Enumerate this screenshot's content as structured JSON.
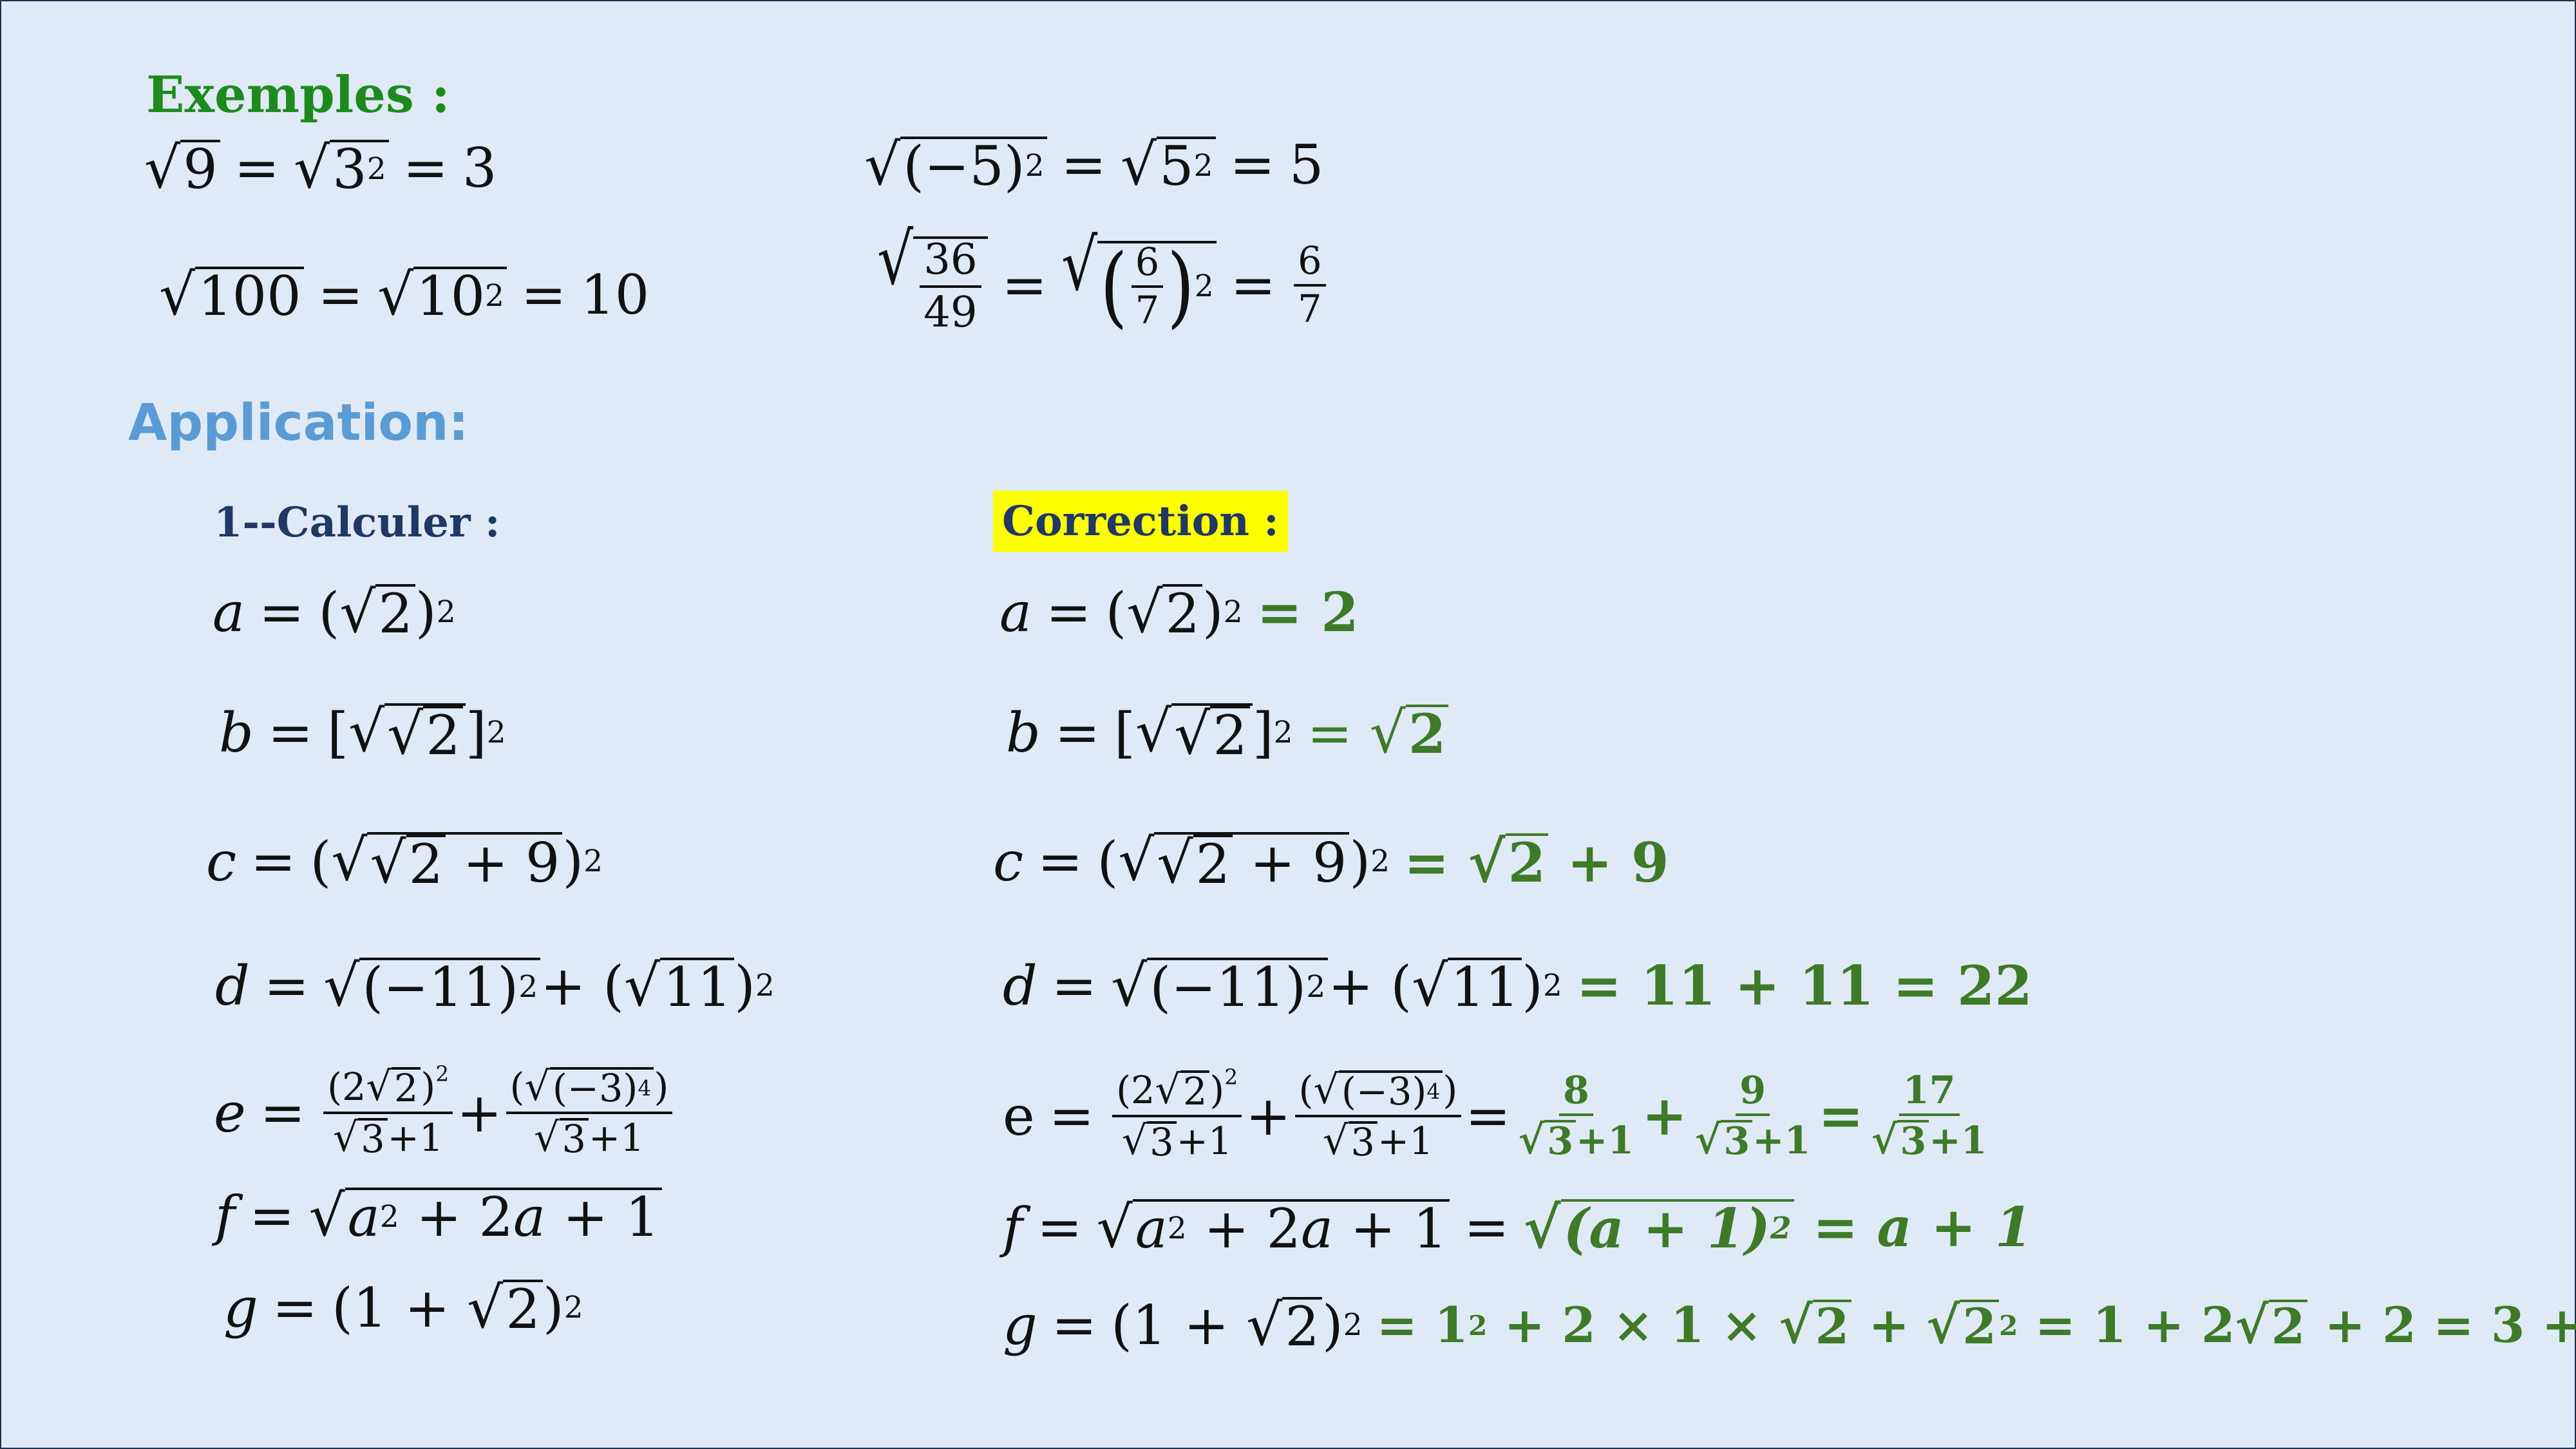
{
  "headings": {
    "examples": "Exemples :",
    "application": "Application:",
    "calculate": "1--Calculer :",
    "correction": "Correction :"
  },
  "colors": {
    "background": "#dfeaf6",
    "examples_title": "#1e8a1e",
    "application_title": "#5b9bd5",
    "calculate_title": "#1f3864",
    "answer_green": "#3e7a28",
    "highlight": "#ffff00"
  }
}
